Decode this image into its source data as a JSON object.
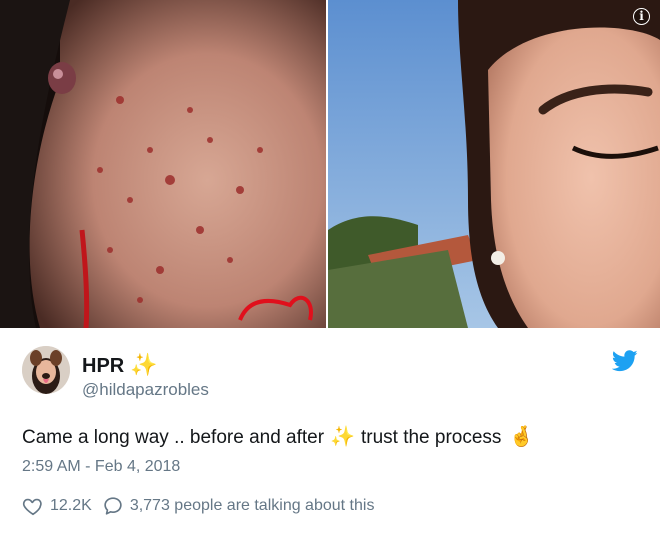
{
  "tweet": {
    "display_name": "HPR",
    "handle": "@hildapazrobles",
    "text_before": "Came a long way .. before and after",
    "text_after": "trust the process",
    "timestamp": "2:59 AM - Feb 4, 2018",
    "likes": "12.2K",
    "talking": "3,773 people are talking about this"
  },
  "icons": {
    "info": "info-icon",
    "twitter": "twitter-bird-icon",
    "sparkles": "sparkles-icon",
    "crossed_fingers": "crossed-fingers-icon",
    "heart": "heart-icon",
    "reply": "speech-bubble-icon"
  },
  "colors": {
    "twitter_blue": "#1da1f2",
    "secondary_text": "#657786",
    "primary_text": "#14171a",
    "sparkle": "#f3c43a"
  }
}
